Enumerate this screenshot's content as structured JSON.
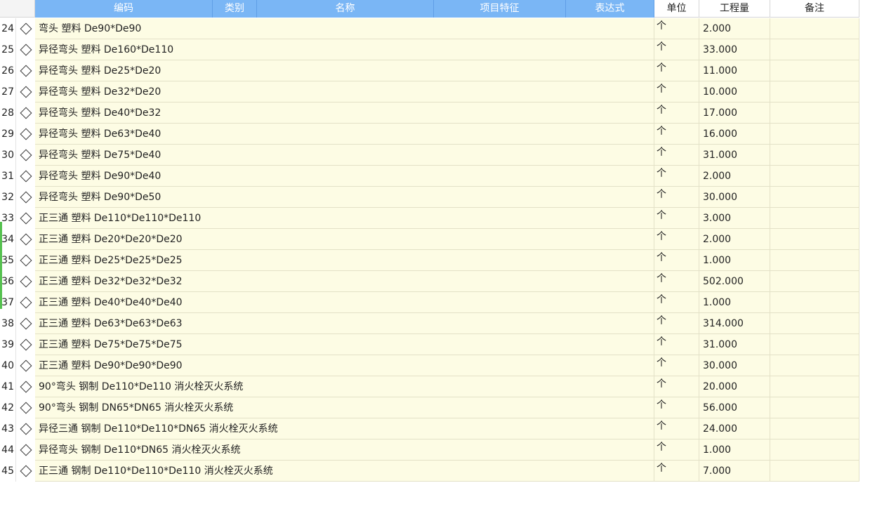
{
  "header": {
    "columns": [
      "编码",
      "类别",
      "名称",
      "项目特征",
      "表达式",
      "单位",
      "工程量",
      "备注"
    ]
  },
  "rows": [
    {
      "num": "24",
      "name": "弯头 塑料 De90*De90",
      "unit": "个",
      "qty": "2.000"
    },
    {
      "num": "25",
      "name": "异径弯头 塑料 De160*De110",
      "unit": "个",
      "qty": "33.000"
    },
    {
      "num": "26",
      "name": "异径弯头 塑料 De25*De20",
      "unit": "个",
      "qty": "11.000"
    },
    {
      "num": "27",
      "name": "异径弯头 塑料 De32*De20",
      "unit": "个",
      "qty": "10.000"
    },
    {
      "num": "28",
      "name": "异径弯头 塑料 De40*De32",
      "unit": "个",
      "qty": "17.000"
    },
    {
      "num": "29",
      "name": "异径弯头 塑料 De63*De40",
      "unit": "个",
      "qty": "16.000"
    },
    {
      "num": "30",
      "name": "异径弯头 塑料 De75*De40",
      "unit": "个",
      "qty": "31.000"
    },
    {
      "num": "31",
      "name": "异径弯头 塑料 De90*De40",
      "unit": "个",
      "qty": "2.000"
    },
    {
      "num": "32",
      "name": "异径弯头 塑料 De90*De50",
      "unit": "个",
      "qty": "30.000"
    },
    {
      "num": "33",
      "name": "正三通 塑料 De110*De110*De110",
      "unit": "个",
      "qty": "3.000"
    },
    {
      "num": "34",
      "name": "正三通 塑料 De20*De20*De20",
      "unit": "个",
      "qty": "2.000"
    },
    {
      "num": "35",
      "name": "正三通 塑料 De25*De25*De25",
      "unit": "个",
      "qty": "1.000"
    },
    {
      "num": "36",
      "name": "正三通 塑料 De32*De32*De32",
      "unit": "个",
      "qty": "502.000"
    },
    {
      "num": "37",
      "name": "正三通 塑料 De40*De40*De40",
      "unit": "个",
      "qty": "1.000"
    },
    {
      "num": "38",
      "name": "正三通 塑料 De63*De63*De63",
      "unit": "个",
      "qty": "314.000"
    },
    {
      "num": "39",
      "name": "正三通 塑料 De75*De75*De75",
      "unit": "个",
      "qty": "31.000"
    },
    {
      "num": "40",
      "name": "正三通 塑料 De90*De90*De90",
      "unit": "个",
      "qty": "30.000"
    },
    {
      "num": "41",
      "name": "90°弯头 钢制 De110*De110 消火栓灭火系统",
      "unit": "个",
      "qty": "20.000"
    },
    {
      "num": "42",
      "name": "90°弯头 钢制 DN65*DN65 消火栓灭火系统",
      "unit": "个",
      "qty": "56.000"
    },
    {
      "num": "43",
      "name": "异径三通 钢制 De110*De110*DN65 消火栓灭火系统",
      "unit": "个",
      "qty": "24.000"
    },
    {
      "num": "44",
      "name": "异径弯头 钢制 De110*DN65 消火栓灭火系统",
      "unit": "个",
      "qty": "1.000"
    },
    {
      "num": "45",
      "name": "正三通 钢制 De110*De110*De110 消火栓灭火系统",
      "unit": "个",
      "qty": "7.000"
    }
  ]
}
